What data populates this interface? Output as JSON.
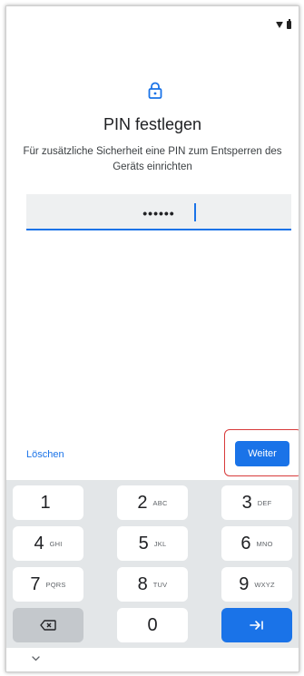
{
  "screen": {
    "title": "PIN festlegen",
    "subtitle": "Für zusätzliche Sicherheit eine PIN zum Entsperren des Geräts einrichten"
  },
  "pin_input": {
    "value": "••••••"
  },
  "actions": {
    "delete_label": "Löschen",
    "next_label": "Weiter"
  },
  "keyboard": {
    "rows": [
      [
        {
          "digit": "1",
          "letters": ""
        },
        {
          "digit": "2",
          "letters": "ABC"
        },
        {
          "digit": "3",
          "letters": "DEF"
        }
      ],
      [
        {
          "digit": "4",
          "letters": "GHI"
        },
        {
          "digit": "5",
          "letters": "JKL"
        },
        {
          "digit": "6",
          "letters": "MNO"
        }
      ],
      [
        {
          "digit": "7",
          "letters": "PQRS"
        },
        {
          "digit": "8",
          "letters": "TUV"
        },
        {
          "digit": "9",
          "letters": "WXYZ"
        }
      ]
    ],
    "zero": "0"
  },
  "icons": {
    "status": [
      "wifi-icon",
      "battery-icon"
    ],
    "header": "lock-icon",
    "backspace": "backspace-icon",
    "enter": "next-key-icon",
    "nav": "chevron-down-icon"
  },
  "colors": {
    "accent": "#1a73e8",
    "highlight": "#d83a3a",
    "keyboard_bg": "#e3e6e8"
  }
}
